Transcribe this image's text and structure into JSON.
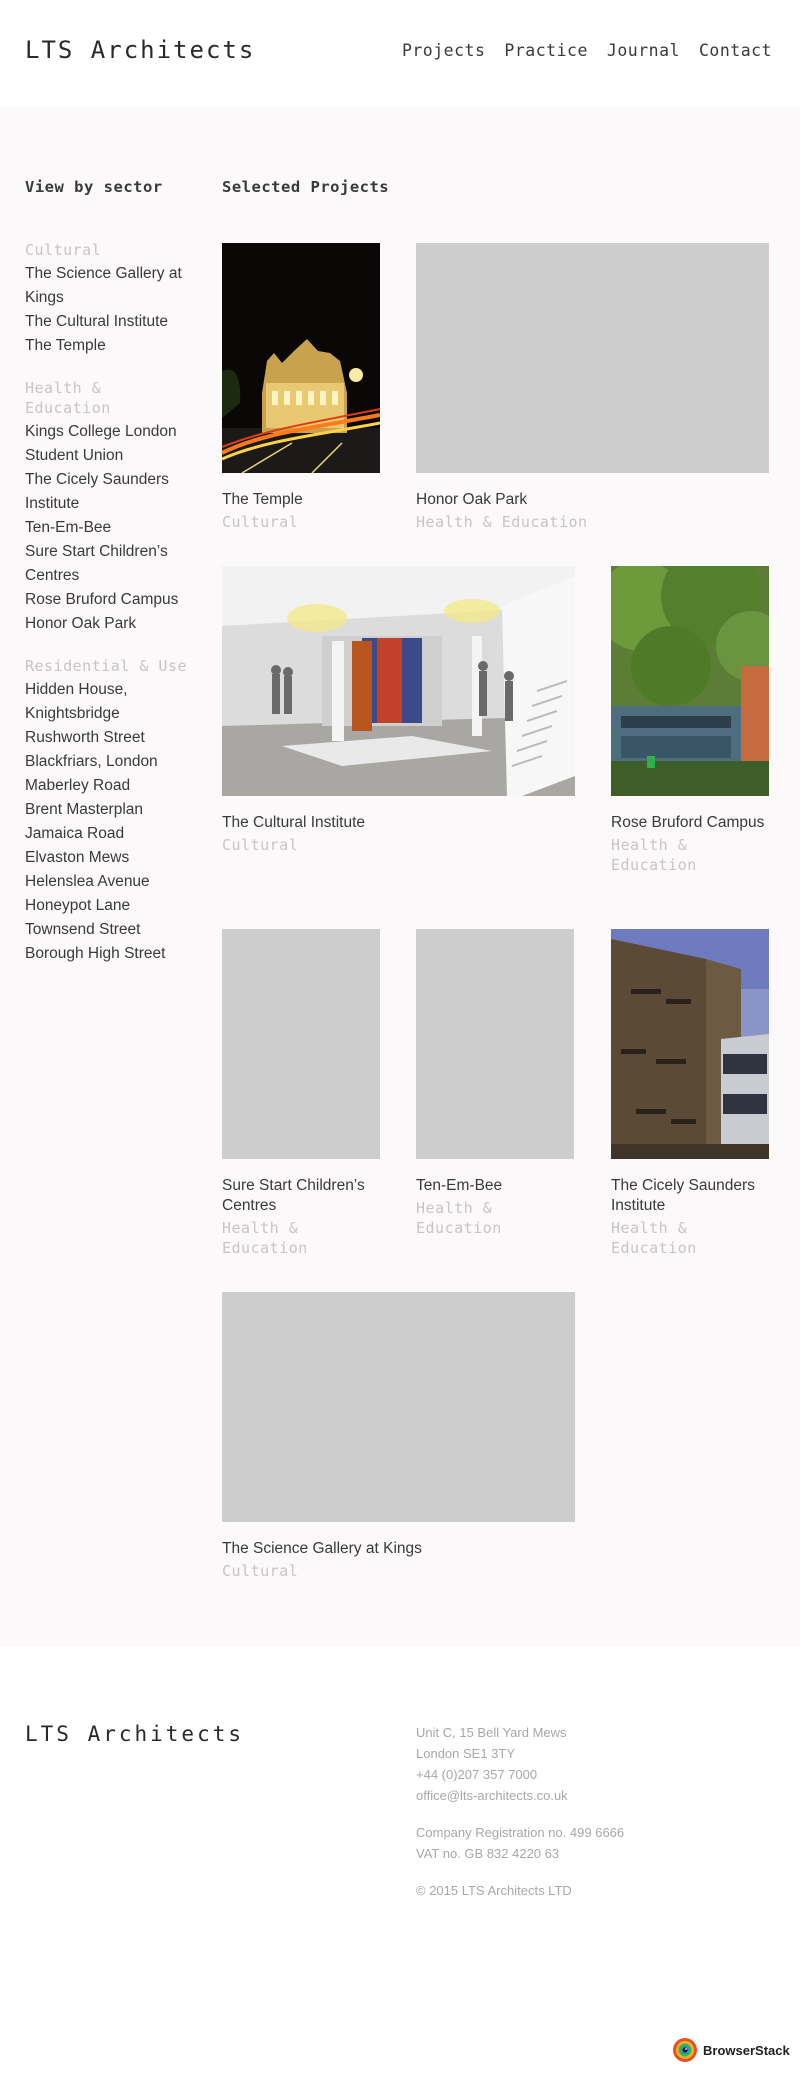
{
  "header": {
    "logo": "LTS Architects",
    "nav": [
      "Projects",
      "Practice",
      "Journal",
      "Contact"
    ]
  },
  "sidebar": {
    "heading": "View by sector",
    "groups": [
      {
        "title": "Cultural",
        "items": [
          "The Science Gallery at Kings",
          "The Cultural Institute",
          "The Temple"
        ]
      },
      {
        "title": "Health & Education",
        "items": [
          "Kings College London Student Union",
          "The Cicely Saunders Institute",
          "Ten-Em-Bee",
          "Sure Start Children’s Centres",
          "Rose Bruford Campus",
          "Honor Oak Park"
        ]
      },
      {
        "title": "Residential & Use",
        "items": [
          "Hidden House, Knightsbridge",
          "Rushworth Street",
          "Blackfriars, London",
          "Maberley Road",
          "Brent Masterplan",
          "Jamaica Road",
          "Elvaston Mews",
          "Helenslea Avenue",
          "Honeypot Lane",
          "Townsend Street",
          "Borough High Street"
        ]
      }
    ]
  },
  "projects": {
    "heading": "Selected Projects",
    "items": [
      {
        "title": "The Temple",
        "sector": "Cultural",
        "image": "night-building"
      },
      {
        "title": "Honor Oak Park",
        "sector": "Health & Education",
        "image": "placeholder"
      },
      {
        "title": "The Cultural Institute",
        "sector": "Cultural",
        "image": "gallery-render"
      },
      {
        "title": "Rose Bruford Campus",
        "sector": "Health & Education",
        "image": "trees-building"
      },
      {
        "title": "Sure Start Children’s Centres",
        "sector": "Health & Education",
        "image": "placeholder"
      },
      {
        "title": "Ten-Em-Bee",
        "sector": "Health & Education",
        "image": "placeholder"
      },
      {
        "title": "The Cicely Saunders Institute",
        "sector": "Health & Education",
        "image": "brick-building"
      },
      {
        "title": "The Science Gallery at Kings",
        "sector": "Cultural",
        "image": "placeholder"
      }
    ]
  },
  "footer": {
    "logo": "LTS Architects",
    "address": [
      "Unit C, 15 Bell Yard Mews",
      "London SE1 3TY",
      "+44 (0)207 357 7000",
      "office@lts-architects.co.uk"
    ],
    "registration": [
      "Company Registration no. 499 6666",
      "VAT no. GB 832 4220 63"
    ],
    "copyright": "© 2015 LTS Architects LTD"
  },
  "badge": {
    "label": "BrowserStack"
  }
}
